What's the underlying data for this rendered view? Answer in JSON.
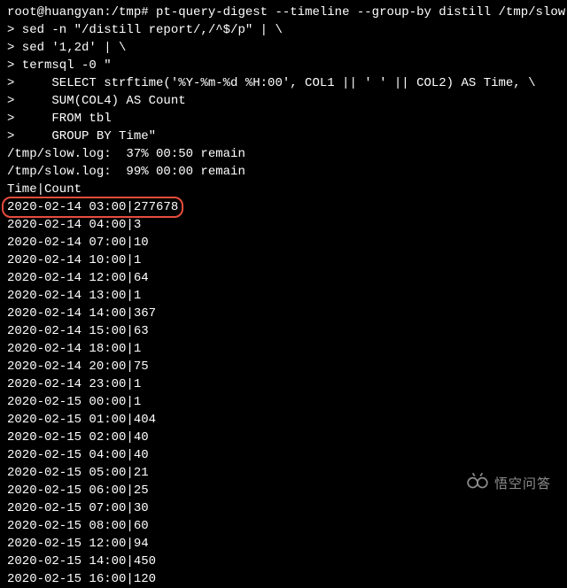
{
  "prompt": {
    "user": "root@huangyan",
    "path": "/tmp",
    "symbol": "#"
  },
  "commands": [
    "pt-query-digest --timeline --group-by distill /tmp/slow.log | \\",
    "> sed -n \"/distill report/,/^$/p\" | \\",
    "> sed '1,2d' | \\",
    "> termsql -0 \"",
    ">     SELECT strftime('%Y-%m-%d %H:00', COL1 || ' ' || COL2) AS Time, \\",
    ">     SUM(COL4) AS Count",
    ">     FROM tbl",
    ">     GROUP BY Time\""
  ],
  "progress": [
    "/tmp/slow.log:  37% 00:50 remain",
    "/tmp/slow.log:  99% 00:00 remain"
  ],
  "header": "Time|Count",
  "highlighted_row": "2020-02-14 03:00|277678",
  "rows": [
    "2020-02-14 04:00|3",
    "2020-02-14 07:00|10",
    "2020-02-14 10:00|1",
    "2020-02-14 12:00|64",
    "2020-02-14 13:00|1",
    "2020-02-14 14:00|367",
    "2020-02-14 15:00|63",
    "2020-02-14 18:00|1",
    "2020-02-14 20:00|75",
    "2020-02-14 23:00|1",
    "2020-02-15 00:00|1",
    "2020-02-15 01:00|404",
    "2020-02-15 02:00|40",
    "2020-02-15 04:00|40",
    "2020-02-15 05:00|21",
    "2020-02-15 06:00|25",
    "2020-02-15 07:00|30",
    "2020-02-15 08:00|60",
    "2020-02-15 12:00|94",
    "2020-02-15 14:00|450",
    "2020-02-15 16:00|120"
  ],
  "watermark_text": "悟空问答"
}
